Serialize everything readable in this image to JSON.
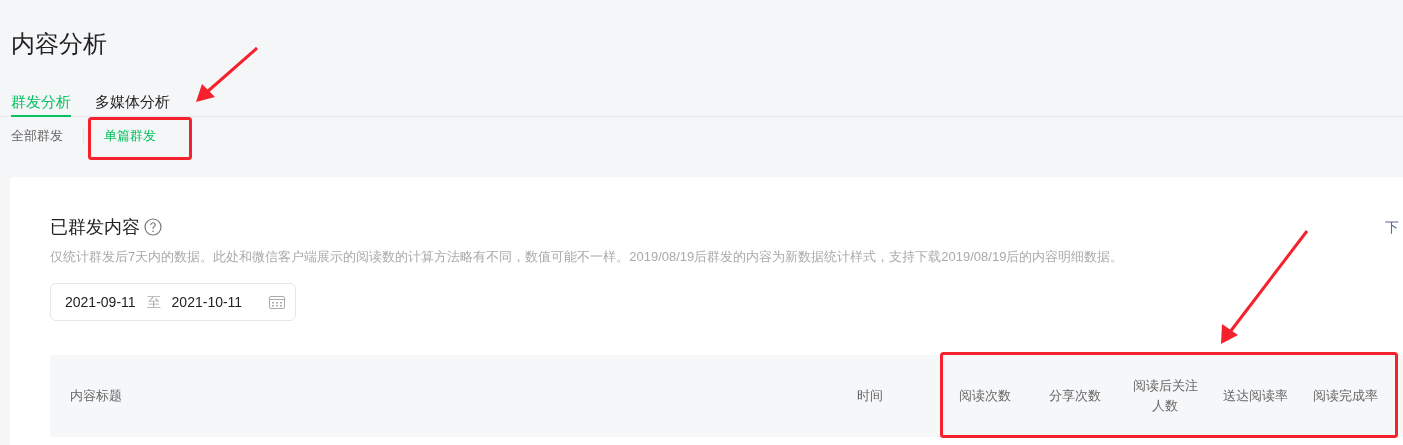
{
  "page_title": "内容分析",
  "tabs": [
    {
      "label": "群发分析",
      "selected": true
    },
    {
      "label": "多媒体分析",
      "selected": false
    }
  ],
  "sub_tabs": [
    {
      "label": "全部群发",
      "selected": false
    },
    {
      "label": "单篇群发",
      "selected": true
    }
  ],
  "section": {
    "title": "已群发内容",
    "download_link": "下",
    "note": "仅统计群发后7天内的数据。此处和微信客户端展示的阅读数的计算方法略有不同，数值可能不一样。2019/08/19后群发的内容为新数据统计样式，支持下载2019/08/19后的内容明细数据。"
  },
  "date_range": {
    "start": "2021-09-11",
    "separator": "至",
    "end": "2021-10-11"
  },
  "table": {
    "columns": [
      "内容标题",
      "时间",
      "阅读次数",
      "分享次数",
      "阅读后关注人数",
      "送达阅读率",
      "阅读完成率"
    ]
  }
}
